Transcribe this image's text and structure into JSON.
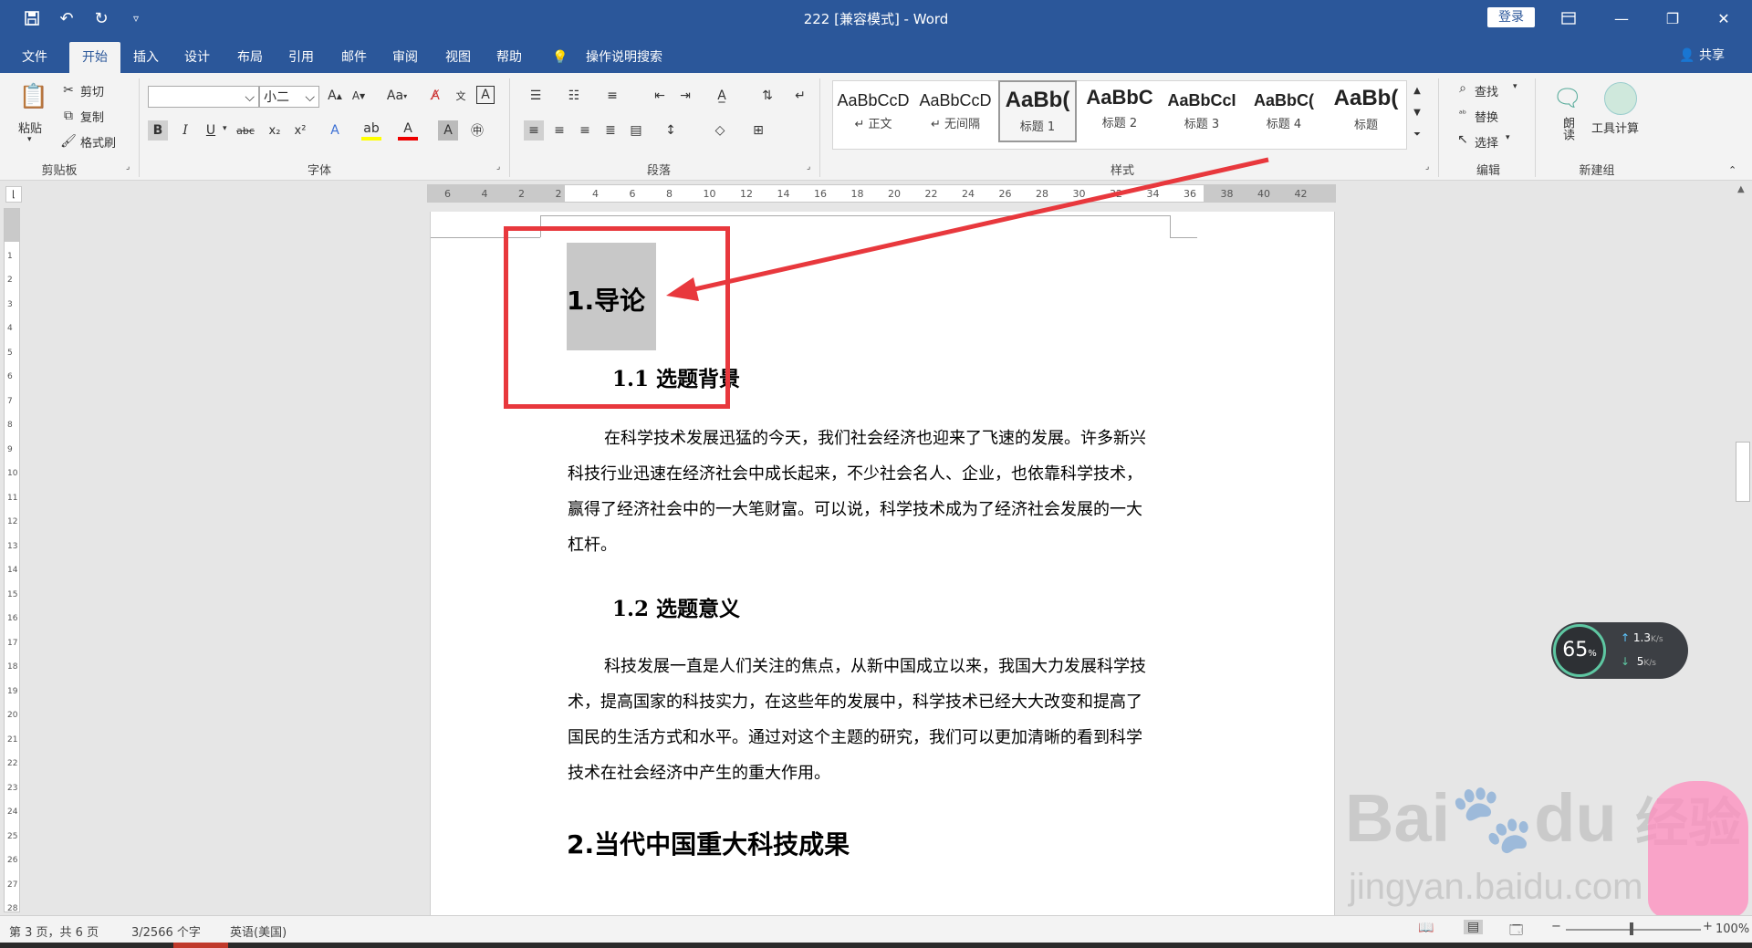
{
  "titlebar": {
    "doc_title": "222 [兼容模式] - Word",
    "login": "登录"
  },
  "tabs": [
    {
      "label": "文件"
    },
    {
      "label": "开始"
    },
    {
      "label": "插入"
    },
    {
      "label": "设计"
    },
    {
      "label": "布局"
    },
    {
      "label": "引用"
    },
    {
      "label": "邮件"
    },
    {
      "label": "审阅"
    },
    {
      "label": "视图"
    },
    {
      "label": "帮助"
    }
  ],
  "tell_me": "操作说明搜索",
  "share": "共享",
  "clipboard": {
    "paste": "粘贴",
    "cut": "剪切",
    "copy": "复制",
    "format_painter": "格式刷",
    "label": "剪贴板"
  },
  "font": {
    "name": "",
    "size": "小二",
    "change_case": "Aa",
    "label": "字体"
  },
  "paragraph": {
    "label": "段落"
  },
  "styles": {
    "label": "样式",
    "items": [
      {
        "preview": "AaBbCcD",
        "name": "↵ 正文"
      },
      {
        "preview": "AaBbCcD",
        "name": "↵ 无间隔"
      },
      {
        "preview": "AaBb(",
        "name": "标题 1"
      },
      {
        "preview": "AaBbC",
        "name": "标题 2"
      },
      {
        "preview": "AaBbCcI",
        "name": "标题 3"
      },
      {
        "preview": "AaBbC(",
        "name": "标题 4"
      },
      {
        "preview": "AaBb(",
        "name": "标题"
      }
    ]
  },
  "editing": {
    "find": "查找",
    "replace": "替换",
    "select": "选择",
    "label": "编辑"
  },
  "newgroup": {
    "read": "朗读",
    "tool": "工具计算",
    "label": "新建组"
  },
  "ruler": {
    "ticks": [
      "6",
      "4",
      "2",
      "2",
      "4",
      "6",
      "8",
      "10",
      "12",
      "14",
      "16",
      "18",
      "20",
      "22",
      "24",
      "26",
      "28",
      "30",
      "32",
      "34",
      "36",
      "38",
      "40",
      "42"
    ]
  },
  "document": {
    "h1": "1.导论",
    "h2_1": "1.1 选题背景",
    "p1": [
      "在科学技术发展迅猛的今天，我们社会经济也迎来了飞速的发展。许多新兴",
      "科技行业迅速在经济社会中成长起来，不少社会名人、企业，也依靠科学技术，",
      "赢得了经济社会中的一大笔财富。可以说，科学技术成为了经济社会发展的一大",
      "杠杆。"
    ],
    "h2_2": "1.2 选题意义",
    "p2": [
      "科技发展一直是人们关注的焦点，从新中国成立以来，我国大力发展科学技",
      "术，提高国家的科技实力，在这些年的发展中，科学技术已经大大改变和提高了",
      "国民的生活方式和水平。通过对这个主题的研究，我们可以更加清晰的看到科学",
      "技术在社会经济中产生的重大作用。"
    ],
    "h1_2": "2.当代中国重大科技成果"
  },
  "net_widget": {
    "percent": "65",
    "pct_sign": "%",
    "up": "1.3",
    "up_unit": "K/s",
    "down": "5",
    "down_unit": "K/s"
  },
  "watermark": {
    "brand": "Bai",
    "brand2": "du",
    "cn": "经验",
    "url": "jingyan.baidu.com"
  },
  "status": {
    "page": "第 3 页，共 6 页",
    "words": "3/2566 个字",
    "lang": "英语(美国)",
    "zoom": "100%"
  },
  "colors": {
    "brand": "#2b579a",
    "annotation": "#e8383d",
    "highlight": "#c8c8c8"
  }
}
